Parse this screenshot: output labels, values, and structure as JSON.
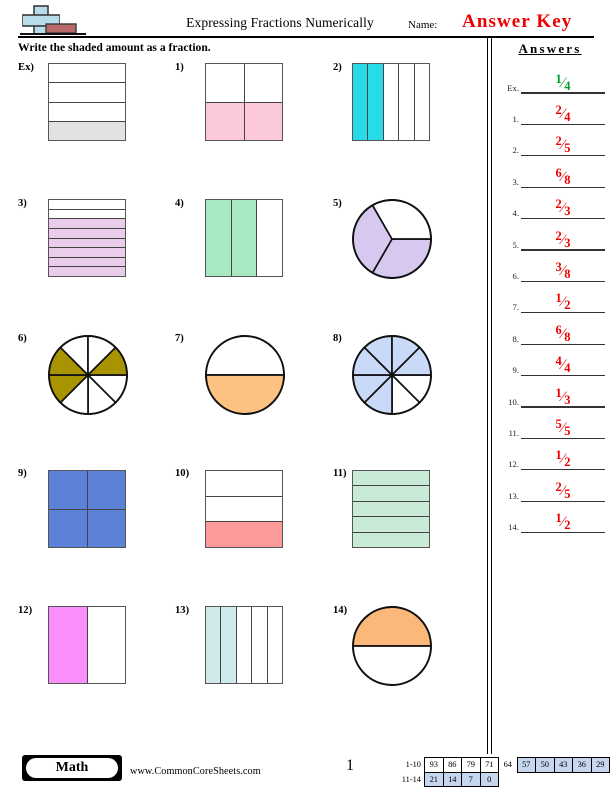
{
  "header": {
    "title": "Expressing Fractions Numerically",
    "name_label": "Name:",
    "answer_key": "Answer Key",
    "logo_icon": "math-plus-minus-icon"
  },
  "instructions": "Write the shaded amount as a fraction.",
  "answers_panel": {
    "heading": "Answers",
    "rows": [
      {
        "label": "Ex.",
        "numerator": "1",
        "denominator": "4",
        "color": "#00a030"
      },
      {
        "label": "1.",
        "numerator": "2",
        "denominator": "4",
        "color": "#ee0000"
      },
      {
        "label": "2.",
        "numerator": "2",
        "denominator": "5",
        "color": "#ee0000"
      },
      {
        "label": "3.",
        "numerator": "6",
        "denominator": "8",
        "color": "#ee0000"
      },
      {
        "label": "4.",
        "numerator": "2",
        "denominator": "3",
        "color": "#ee0000"
      },
      {
        "label": "5.",
        "numerator": "2",
        "denominator": "3",
        "color": "#ee0000"
      },
      {
        "label": "6.",
        "numerator": "3",
        "denominator": "8",
        "color": "#ee0000"
      },
      {
        "label": "7.",
        "numerator": "1",
        "denominator": "2",
        "color": "#ee0000"
      },
      {
        "label": "8.",
        "numerator": "6",
        "denominator": "8",
        "color": "#ee0000"
      },
      {
        "label": "9.",
        "numerator": "4",
        "denominator": "4",
        "color": "#ee0000"
      },
      {
        "label": "10.",
        "numerator": "1",
        "denominator": "3",
        "color": "#ee0000"
      },
      {
        "label": "11.",
        "numerator": "5",
        "denominator": "5",
        "color": "#ee0000"
      },
      {
        "label": "12.",
        "numerator": "1",
        "denominator": "2",
        "color": "#ee0000"
      },
      {
        "label": "13.",
        "numerator": "2",
        "denominator": "5",
        "color": "#ee0000"
      },
      {
        "label": "14.",
        "numerator": "1",
        "denominator": "2",
        "color": "#ee0000"
      }
    ]
  },
  "problems": [
    {
      "label": "Ex)",
      "shape": "bar-h",
      "parts": 4,
      "shaded": [
        3
      ],
      "fill": "#e2e2e2"
    },
    {
      "label": "1)",
      "shape": "grid2",
      "parts": 4,
      "shaded": [
        2,
        3
      ],
      "fill": "#fcc9d8"
    },
    {
      "label": "2)",
      "shape": "bar-v",
      "parts": 5,
      "shaded": [
        0,
        1
      ],
      "fill": "#27dbe8"
    },
    {
      "label": "3)",
      "shape": "bar-h",
      "parts": 8,
      "shaded": [
        2,
        3,
        4,
        5,
        6,
        7
      ],
      "fill": "#e9cdea"
    },
    {
      "label": "4)",
      "shape": "bar-v",
      "parts": 3,
      "shaded": [
        0,
        1
      ],
      "fill": "#a8e9c4"
    },
    {
      "label": "5)",
      "shape": "pie",
      "parts": 3,
      "shaded": [
        0,
        1
      ],
      "fill": "#d6c8ee"
    },
    {
      "label": "6)",
      "shape": "pie",
      "parts": 8,
      "shaded": [
        3,
        4,
        7
      ],
      "fill": "#a89400"
    },
    {
      "label": "7)",
      "shape": "pie",
      "parts": 2,
      "shaded": [
        1
      ],
      "fill": "#fcc281"
    },
    {
      "label": "8)",
      "shape": "pie",
      "parts": 8,
      "shaded": [
        2,
        3,
        4,
        5,
        6,
        7
      ],
      "fill": "#c8daf7"
    },
    {
      "label": "9)",
      "shape": "grid2",
      "parts": 4,
      "shaded": [
        0,
        1,
        2,
        3
      ],
      "fill": "#5c82d8"
    },
    {
      "label": "10)",
      "shape": "bar-h",
      "parts": 3,
      "shaded": [
        2
      ],
      "fill": "#fc9a9a"
    },
    {
      "label": "11)",
      "shape": "bar-h",
      "parts": 5,
      "shaded": [
        0,
        1,
        2,
        3,
        4
      ],
      "fill": "#c9ead6"
    },
    {
      "label": "12)",
      "shape": "bar-v",
      "parts": 2,
      "shaded": [
        0
      ],
      "fill": "#fa8efa"
    },
    {
      "label": "13)",
      "shape": "bar-v",
      "parts": 5,
      "shaded": [
        0,
        1
      ],
      "fill": "#cfeaea"
    },
    {
      "label": "14)",
      "shape": "pie",
      "parts": 2,
      "shaded": [
        0
      ],
      "fill": "#fcb87a"
    }
  ],
  "footer": {
    "badge": "Math",
    "website": "www.CommonCoreSheets.com",
    "page_number": "1",
    "score_table": {
      "row1_label": "1-10",
      "row2_label": "11-14",
      "row1": [
        {
          "value": "93",
          "shaded": false,
          "boxed": true
        },
        {
          "value": "86",
          "shaded": false,
          "boxed": true
        },
        {
          "value": "79",
          "shaded": false,
          "boxed": true
        },
        {
          "value": "71",
          "shaded": false,
          "boxed": true
        },
        {
          "value": "64",
          "shaded": false,
          "boxed": false
        },
        {
          "value": "57",
          "shaded": true,
          "boxed": true
        },
        {
          "value": "50",
          "shaded": true,
          "boxed": true
        },
        {
          "value": "43",
          "shaded": true,
          "boxed": true
        },
        {
          "value": "36",
          "shaded": true,
          "boxed": true
        },
        {
          "value": "29",
          "shaded": true,
          "boxed": true
        }
      ],
      "row2": [
        {
          "value": "21",
          "shaded": true,
          "boxed": true
        },
        {
          "value": "14",
          "shaded": true,
          "boxed": true
        },
        {
          "value": "7",
          "shaded": true,
          "boxed": true
        },
        {
          "value": "0",
          "shaded": true,
          "boxed": true
        }
      ]
    }
  }
}
